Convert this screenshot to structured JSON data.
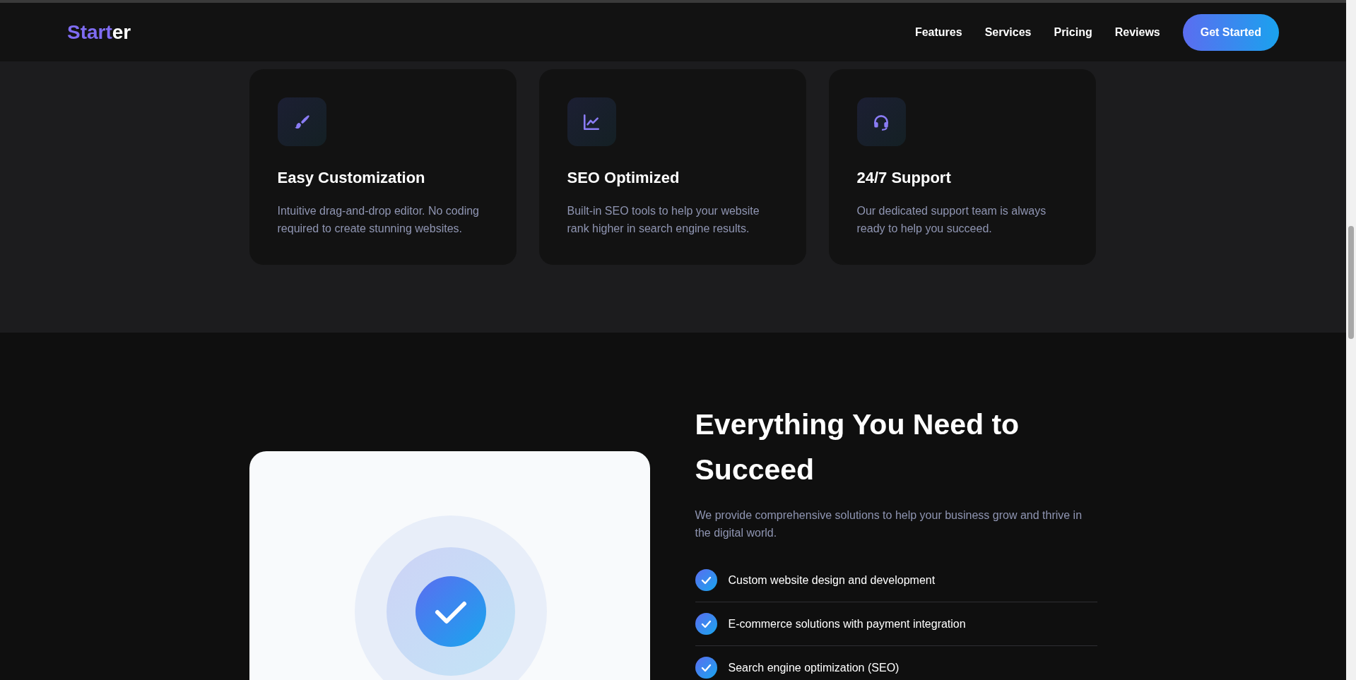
{
  "navbar": {
    "logo": {
      "accent": "Start",
      "rest": "er"
    },
    "links": [
      "Features",
      "Services",
      "Pricing",
      "Reviews"
    ],
    "cta": "Get Started"
  },
  "features": [
    {
      "title": "Easy Customization",
      "text": "Intuitive drag-and-drop editor. No coding required to create stunning websites."
    },
    {
      "title": "SEO Optimized",
      "text": "Built-in SEO tools to help your website rank higher in search engine results."
    },
    {
      "title": "24/7 Support",
      "text": "Our dedicated support team is always ready to help you succeed."
    }
  ],
  "about": {
    "heading": "Everything You Need to Succeed",
    "text": "We provide comprehensive solutions to help your business grow and thrive in the digital world.",
    "items": [
      "Custom website design and development",
      "E-commerce solutions with payment integration",
      "Search engine optimization (SEO)"
    ]
  }
}
